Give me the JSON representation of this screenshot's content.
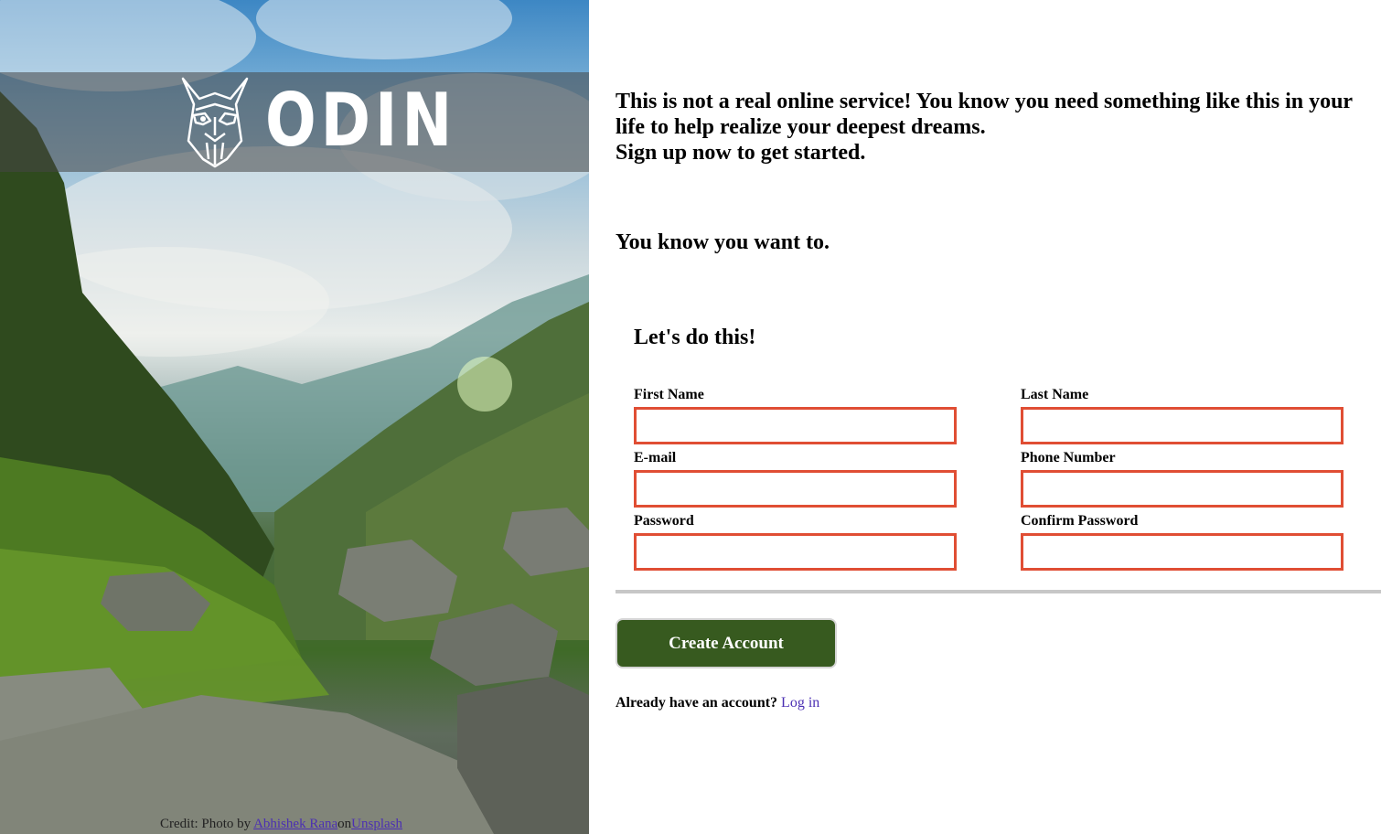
{
  "brand": {
    "name": "ODIN",
    "logo_icon": "viking-helmet-icon"
  },
  "hero": {
    "credit": {
      "prefix": "Credit: Photo by ",
      "author": "Abhishek Rana",
      "separator": "on",
      "source": "Unsplash"
    }
  },
  "intro": {
    "line1": "This is not a real online service! You know you need something like this in your life to help realize your deepest dreams.",
    "line2": "Sign up now to get started.",
    "tagline": "You know you want to."
  },
  "form": {
    "title": "Let's do this!",
    "fields": {
      "first_name": {
        "label": "First Name",
        "value": ""
      },
      "last_name": {
        "label": "Last Name",
        "value": ""
      },
      "email": {
        "label": "E-mail",
        "value": ""
      },
      "phone": {
        "label": "Phone Number",
        "value": ""
      },
      "password": {
        "label": "Password",
        "value": ""
      },
      "confirm_password": {
        "label": "Confirm Password",
        "value": ""
      }
    },
    "submit_label": "Create Account",
    "login_prompt": "Already have an account?",
    "login_link": "Log in"
  },
  "colors": {
    "input_border": "#e04e34",
    "button_bg": "#375a1f",
    "link": "#4b2fb3",
    "divider": "#c7c7c7"
  }
}
